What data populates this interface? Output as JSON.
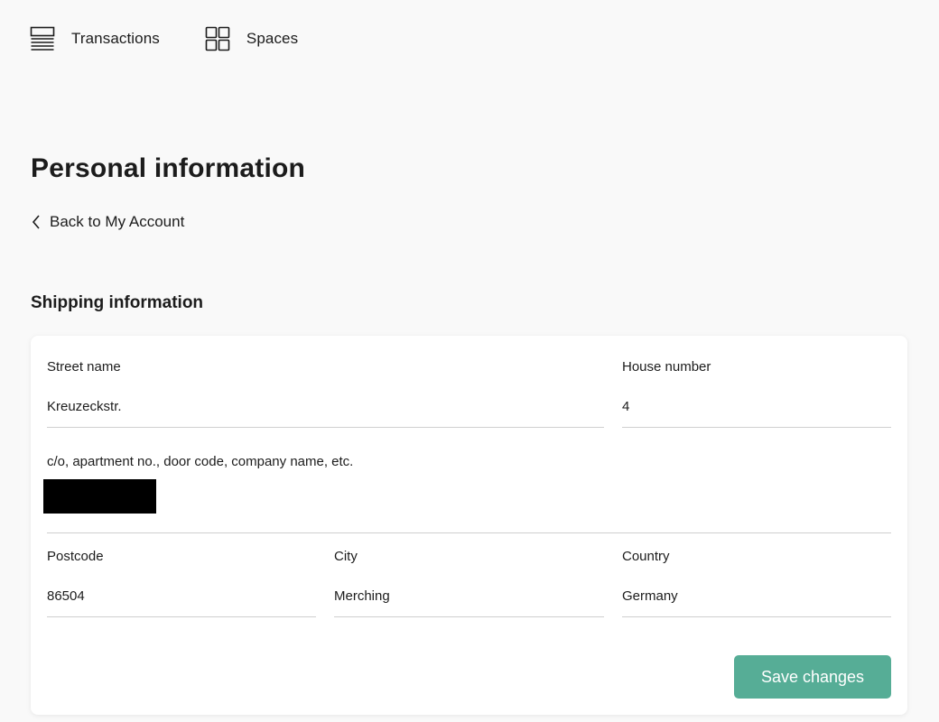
{
  "nav": {
    "items": [
      {
        "label": "Transactions",
        "icon": "list-icon"
      },
      {
        "label": "Spaces",
        "icon": "grid-icon"
      }
    ]
  },
  "page": {
    "title": "Personal information",
    "back_label": "Back to My Account"
  },
  "shipping": {
    "section_title": "Shipping information",
    "street_label": "Street name",
    "street_value": "Kreuzeckstr.",
    "house_label": "House number",
    "house_value": "4",
    "extra_label": "c/o, apartment no., door code, company name, etc.",
    "extra_value": "",
    "postcode_label": "Postcode",
    "postcode_value": "86504",
    "city_label": "City",
    "city_value": "Merching",
    "country_label": "Country",
    "country_value": "Germany",
    "save_label": "Save changes"
  },
  "colors": {
    "accent": "#56ad96",
    "background": "#f9f9f9",
    "card": "#ffffff",
    "text": "#1c1c1c",
    "divider": "#cfcfcf"
  }
}
